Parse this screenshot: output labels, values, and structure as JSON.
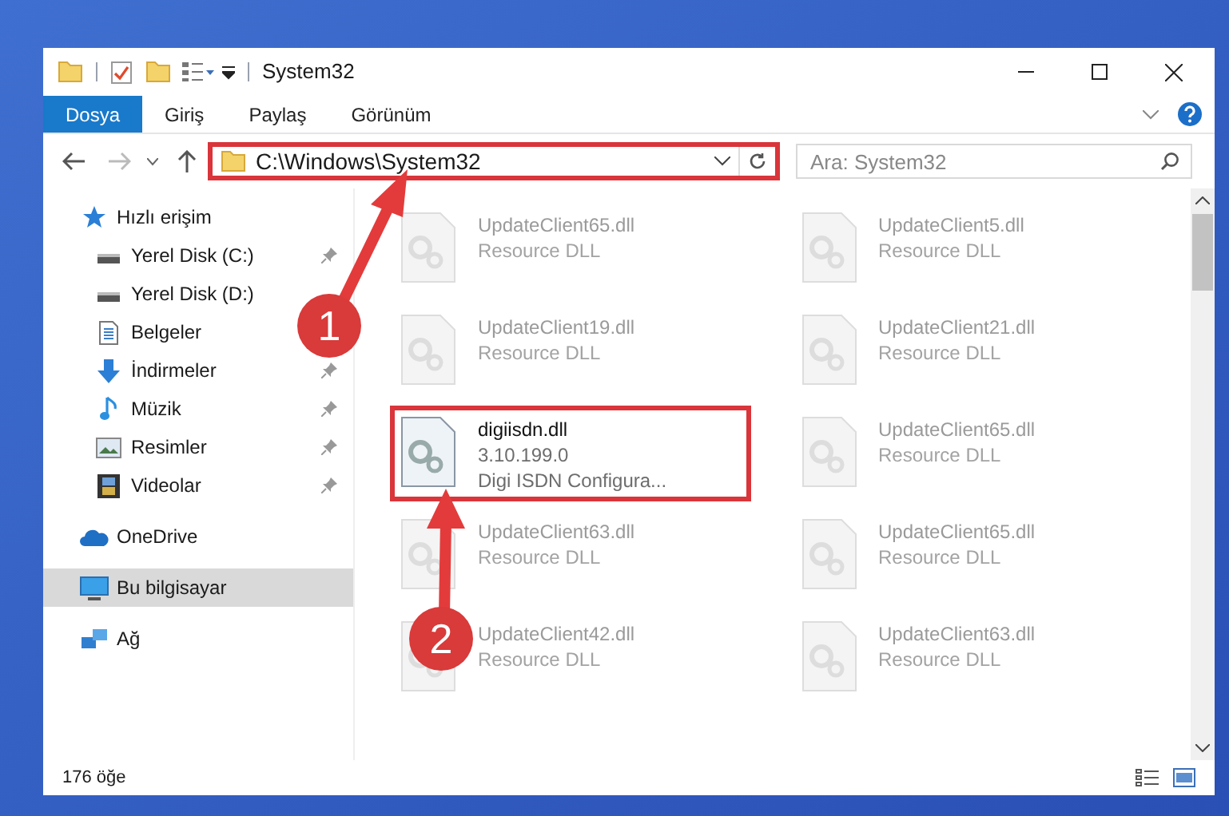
{
  "window": {
    "title": "System32"
  },
  "ribbon_tabs": [
    {
      "label": "Dosya",
      "selected": true
    },
    {
      "label": "Giriş",
      "selected": false
    },
    {
      "label": "Paylaş",
      "selected": false
    },
    {
      "label": "Görünüm",
      "selected": false
    }
  ],
  "address_bar": {
    "path": "C:\\Windows\\System32",
    "highlighted": true
  },
  "search": {
    "placeholder": "Ara: System32"
  },
  "sidebar": {
    "items": [
      {
        "label": "Hızlı erişim",
        "kind": "star",
        "selected": false,
        "children": [
          {
            "label": "Yerel Disk (C:)",
            "kind": "drive",
            "pinned": true,
            "selected": false
          },
          {
            "label": "Yerel Disk (D:)",
            "kind": "drive",
            "pinned": false,
            "selected": false
          },
          {
            "label": "Belgeler",
            "kind": "docs",
            "pinned": false,
            "selected": false
          },
          {
            "label": "İndirmeler",
            "kind": "download",
            "pinned": true,
            "selected": false
          },
          {
            "label": "Müzik",
            "kind": "music",
            "pinned": true,
            "selected": false
          },
          {
            "label": "Resimler",
            "kind": "pictures",
            "pinned": true,
            "selected": false
          },
          {
            "label": "Videolar",
            "kind": "videos",
            "pinned": true,
            "selected": false
          }
        ]
      },
      {
        "label": "OneDrive",
        "kind": "cloud",
        "selected": false
      },
      {
        "label": "Bu bilgisayar",
        "kind": "computer",
        "selected": true
      },
      {
        "label": "Ağ",
        "kind": "network",
        "selected": false
      }
    ]
  },
  "files": [
    {
      "name": "UpdateClient65.dll",
      "lines": [
        "Resource DLL"
      ],
      "highlighted": false
    },
    {
      "name": "UpdateClient5.dll",
      "lines": [
        "Resource DLL"
      ],
      "highlighted": false
    },
    {
      "name": "UpdateClient19.dll",
      "lines": [
        "Resource DLL"
      ],
      "highlighted": false
    },
    {
      "name": "UpdateClient21.dll",
      "lines": [
        "Resource DLL"
      ],
      "highlighted": false
    },
    {
      "name": "digiisdn.dll",
      "lines": [
        "3.10.199.0",
        "Digi ISDN Configura..."
      ],
      "highlighted": true
    },
    {
      "name": "UpdateClient65.dll",
      "lines": [
        "Resource DLL"
      ],
      "highlighted": false
    },
    {
      "name": "UpdateClient63.dll",
      "lines": [
        "Resource DLL"
      ],
      "highlighted": false
    },
    {
      "name": "UpdateClient65.dll",
      "lines": [
        "Resource DLL"
      ],
      "highlighted": false
    },
    {
      "name": "UpdateClient42.dll",
      "lines": [
        "Resource DLL"
      ],
      "highlighted": false
    },
    {
      "name": "UpdateClient63.dll",
      "lines": [
        "Resource DLL"
      ],
      "highlighted": false
    }
  ],
  "status_bar": {
    "item_count": "176 öğe"
  },
  "callouts": [
    {
      "number": "1"
    },
    {
      "number": "2"
    }
  ]
}
